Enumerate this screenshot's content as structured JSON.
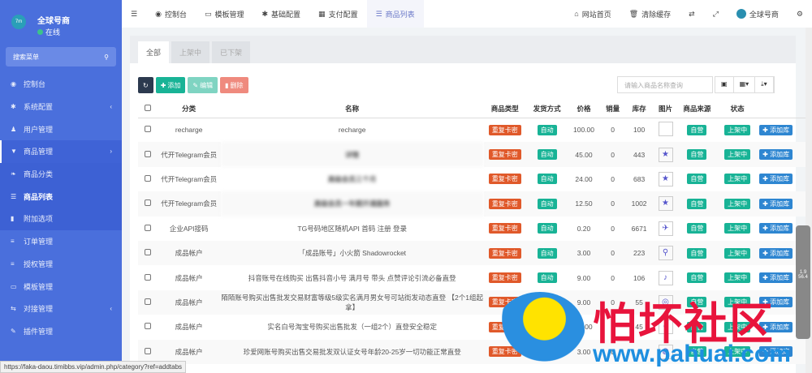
{
  "sidebar": {
    "user": "全球号商",
    "status": "在线",
    "logo": "7m",
    "search": "搜索菜单",
    "items": [
      {
        "label": "控制台",
        "icon": "dashboard-icon",
        "g": "◉"
      },
      {
        "label": "系统配置",
        "icon": "gear-icon",
        "g": "✱",
        "arrow": "‹"
      },
      {
        "label": "用户管理",
        "icon": "user-icon",
        "g": "♟"
      },
      {
        "label": "商品管理",
        "icon": "cart-icon",
        "g": "▼",
        "arrow": "›",
        "open": true
      },
      {
        "label": "商品分类",
        "icon": "leaf-icon",
        "g": "❧",
        "sub": true
      },
      {
        "label": "商品列表",
        "icon": "list-icon",
        "g": "☰",
        "sub": true,
        "active": true
      },
      {
        "label": "附加选项",
        "icon": "bookmark-icon",
        "g": "▮",
        "sub": true
      },
      {
        "label": "订单管理",
        "icon": "list-icon",
        "g": "≡"
      },
      {
        "label": "授权管理",
        "icon": "list-icon",
        "g": "≡"
      },
      {
        "label": "模板管理",
        "icon": "window-icon",
        "g": "▭"
      },
      {
        "label": "对接管理",
        "icon": "link-icon",
        "g": "⇆",
        "arrow": "‹"
      },
      {
        "label": "插件管理",
        "icon": "plug-icon",
        "g": "✎"
      }
    ]
  },
  "topbar": {
    "tabs": [
      {
        "label": "控制台",
        "g": "◉"
      },
      {
        "label": "模板管理",
        "g": "▭"
      },
      {
        "label": "基础配置",
        "g": "✱"
      },
      {
        "label": "支付配置",
        "g": "▦"
      },
      {
        "label": "商品列表",
        "g": "☰",
        "active": true
      }
    ],
    "home": "网站首页",
    "clear": "清除缓存",
    "user": "全球号商"
  },
  "tabs": [
    "全部",
    "上架中",
    "已下架"
  ],
  "toolbar": {
    "add": "添加",
    "edit": "编辑",
    "delete": "删除",
    "search_placeholder": "请输入商品名称查询"
  },
  "columns": [
    "分类",
    "名称",
    "商品类型",
    "发货方式",
    "价格",
    "销量",
    "库存",
    "图片",
    "商品来源",
    "状态"
  ],
  "rows": [
    {
      "cat": "recharge",
      "name": "recharge",
      "price": "100.00",
      "sales": "0",
      "stock": "100",
      "img": "broken"
    },
    {
      "cat": "代开Telegram会员",
      "name": "详情",
      "blur": true,
      "price": "45.00",
      "sales": "0",
      "stock": "443",
      "img": "★"
    },
    {
      "cat": "代开Telegram会员",
      "name": "高级会员三个月",
      "blur": true,
      "price": "24.00",
      "sales": "0",
      "stock": "683",
      "img": "★"
    },
    {
      "cat": "代开Telegram会员",
      "name": "高级会员一年期开通服务",
      "blur": true,
      "price": "12.50",
      "sales": "0",
      "stock": "1002",
      "img": "★"
    },
    {
      "cat": "企业API接码",
      "name": "TG号码地区随机API 首码 注册 登录",
      "price": "0.20",
      "sales": "0",
      "stock": "6671",
      "img": "✈"
    },
    {
      "cat": "成品帐户",
      "name": "「成品账号」小火箭 Shadowrocket",
      "price": "3.00",
      "sales": "0",
      "stock": "223",
      "img": "⚲"
    },
    {
      "cat": "成品帐户",
      "name": "抖音账号在线购买 出售抖音小号 满月号 带头 点赞评论引流必备直登",
      "price": "9.00",
      "sales": "0",
      "stock": "106",
      "img": "♪"
    },
    {
      "cat": "成品帐户",
      "name": "陌陌账号购买出售批发交易财富等级5级实名满月男女号可站街发动态直登 【2个1组起拿】",
      "price": "9.00",
      "sales": "0",
      "stock": "55",
      "img": "◎"
    },
    {
      "cat": "成品帐户",
      "name": "实名白号淘宝号购买出售批发（一组2个）直登安全稳定",
      "price": "13.00",
      "sales": "0",
      "stock": "45",
      "img": "◐"
    },
    {
      "cat": "成品帐户",
      "name": "珍爱网账号购买出售交易批发双认证女号年龄20-25岁一切功能正常直登",
      "price": "3.00",
      "sales": "0",
      "stock": "3",
      "img": "◍"
    }
  ],
  "labels": {
    "type": "重复卡密",
    "delivery": "自动",
    "source": "自营",
    "status": "上架中",
    "action": "添加库"
  },
  "colors": {
    "sidebar": "#4a6fdc",
    "type": "#e0592a",
    "green": "#18b396",
    "action": "#2e86d1"
  },
  "status_url": "https://faka-daou.timibbs.vip/admin.php/category?ref=addtabs",
  "watermark": {
    "text": "怕坏社区",
    "url": "www.pahuai.com"
  },
  "float": {
    "up": "1.9",
    "down": "56.4"
  }
}
